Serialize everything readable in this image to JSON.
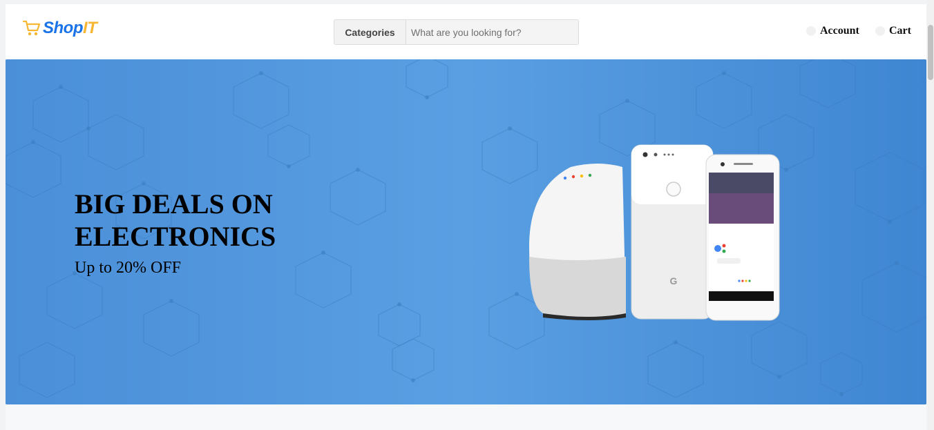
{
  "header": {
    "logo": {
      "shop": "Shop",
      "it": "IT",
      "icon": "cart-icon"
    },
    "search": {
      "categories_label": "Categories",
      "placeholder": "What are you looking for?",
      "value": ""
    },
    "nav": {
      "account_label": "Account",
      "cart_label": "Cart"
    }
  },
  "hero": {
    "title": "BIG DEALS ON ELECTRONICS",
    "subtitle": "Up to 20% OFF",
    "background_color": "#4a90d9",
    "product_image": "smart-speaker-and-phones-image"
  },
  "colors": {
    "brand_blue": "#1a73e8",
    "brand_yellow": "#f7b733",
    "hero_blue": "#4a90d9"
  }
}
